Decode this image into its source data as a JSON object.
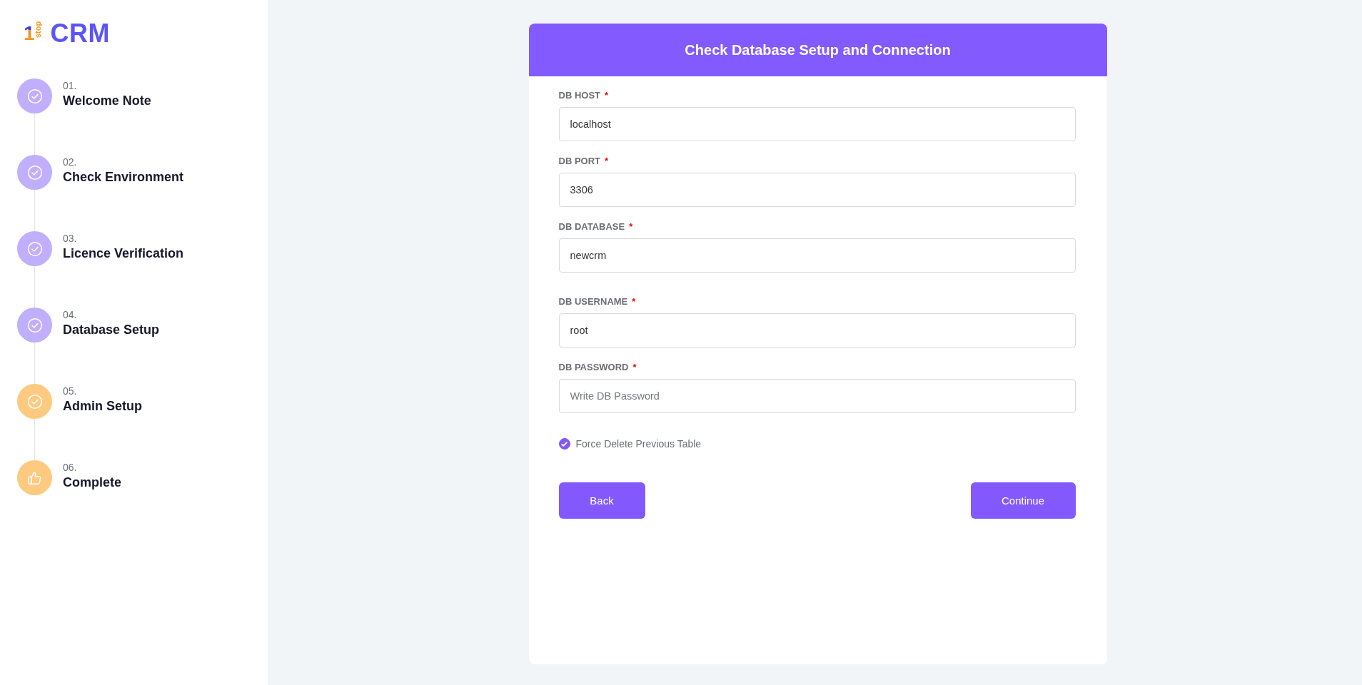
{
  "logo": {
    "mark_digit": "1",
    "mark_word": "stop",
    "name": "CRM"
  },
  "steps": [
    {
      "number": "01.",
      "title": "Welcome Note",
      "color": "#c0affc",
      "kind": "check"
    },
    {
      "number": "02.",
      "title": "Check Environment",
      "color": "#c0affc",
      "kind": "check"
    },
    {
      "number": "03.",
      "title": "Licence Verification",
      "color": "#c0affc",
      "kind": "check"
    },
    {
      "number": "04.",
      "title": "Database Setup",
      "color": "#c0affc",
      "kind": "check"
    },
    {
      "number": "05.",
      "title": "Admin Setup",
      "color": "#fdca80",
      "kind": "check"
    },
    {
      "number": "06.",
      "title": "Complete",
      "color": "#fdca80",
      "kind": "thumbs"
    }
  ],
  "form": {
    "title": "Check Database Setup and Connection",
    "fields": [
      {
        "label": "DB HOST",
        "required_mark": "*",
        "value": "localhost"
      },
      {
        "label": "DB PORT",
        "required_mark": "*",
        "value": "3306"
      },
      {
        "label": "DB DATABASE",
        "required_mark": "*",
        "value": "newcrm"
      },
      {
        "label": "DB USERNAME",
        "required_mark": "*",
        "value": "root"
      },
      {
        "label": "DB PASSWORD",
        "required_mark": "*",
        "placeholder": "Write DB Password"
      }
    ],
    "checkbox": {
      "label": "Force Delete Previous Table",
      "checked": true
    },
    "buttons": [
      {
        "label": "Back"
      },
      {
        "label": "Continue"
      }
    ]
  }
}
